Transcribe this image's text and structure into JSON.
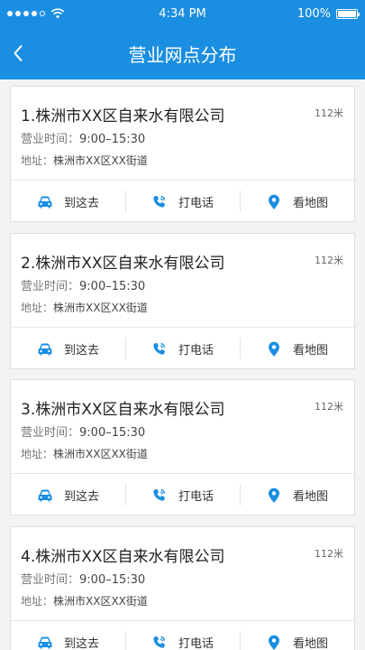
{
  "status_bar": {
    "time": "4:34 PM",
    "battery": "100%",
    "signal_bars": 4,
    "signal_total": 5
  },
  "header": {
    "title": "营业网点分布",
    "back_icon": "chevron-left-icon"
  },
  "colors": {
    "header_bg": "#1a8ee1",
    "icon_blue": "#1a8ee1",
    "page_bg": "#f2f3f5"
  },
  "branches": [
    {
      "name": "1.株洲市XX区自来水有限公司",
      "distance": "112米",
      "hours_label": "营业时间：",
      "hours": "9:00–15:30",
      "address_label": "地址：",
      "address": "株洲市XX区XX街道",
      "actions": {
        "navigate": "到这去",
        "call": "打电话",
        "map": "看地图"
      }
    },
    {
      "name": "2.株洲市XX区自来水有限公司",
      "distance": "112米",
      "hours_label": "营业时间：",
      "hours": "9:00–15:30",
      "address_label": "地址：",
      "address": "株洲市XX区XX街道",
      "actions": {
        "navigate": "到这去",
        "call": "打电话",
        "map": "看地图"
      }
    },
    {
      "name": "3.株洲市XX区自来水有限公司",
      "distance": "112米",
      "hours_label": "营业时间：",
      "hours": "9:00–15:30",
      "address_label": "地址：",
      "address": "株洲市XX区XX街道",
      "actions": {
        "navigate": "到这去",
        "call": "打电话",
        "map": "看地图"
      }
    },
    {
      "name": "4.株洲市XX区自来水有限公司",
      "distance": "112米",
      "hours_label": "营业时间：",
      "hours": "9:00–15:30",
      "address_label": "地址：",
      "address": "株洲市XX区XX街道",
      "actions": {
        "navigate": "到这去",
        "call": "打电话",
        "map": "看地图"
      }
    }
  ]
}
